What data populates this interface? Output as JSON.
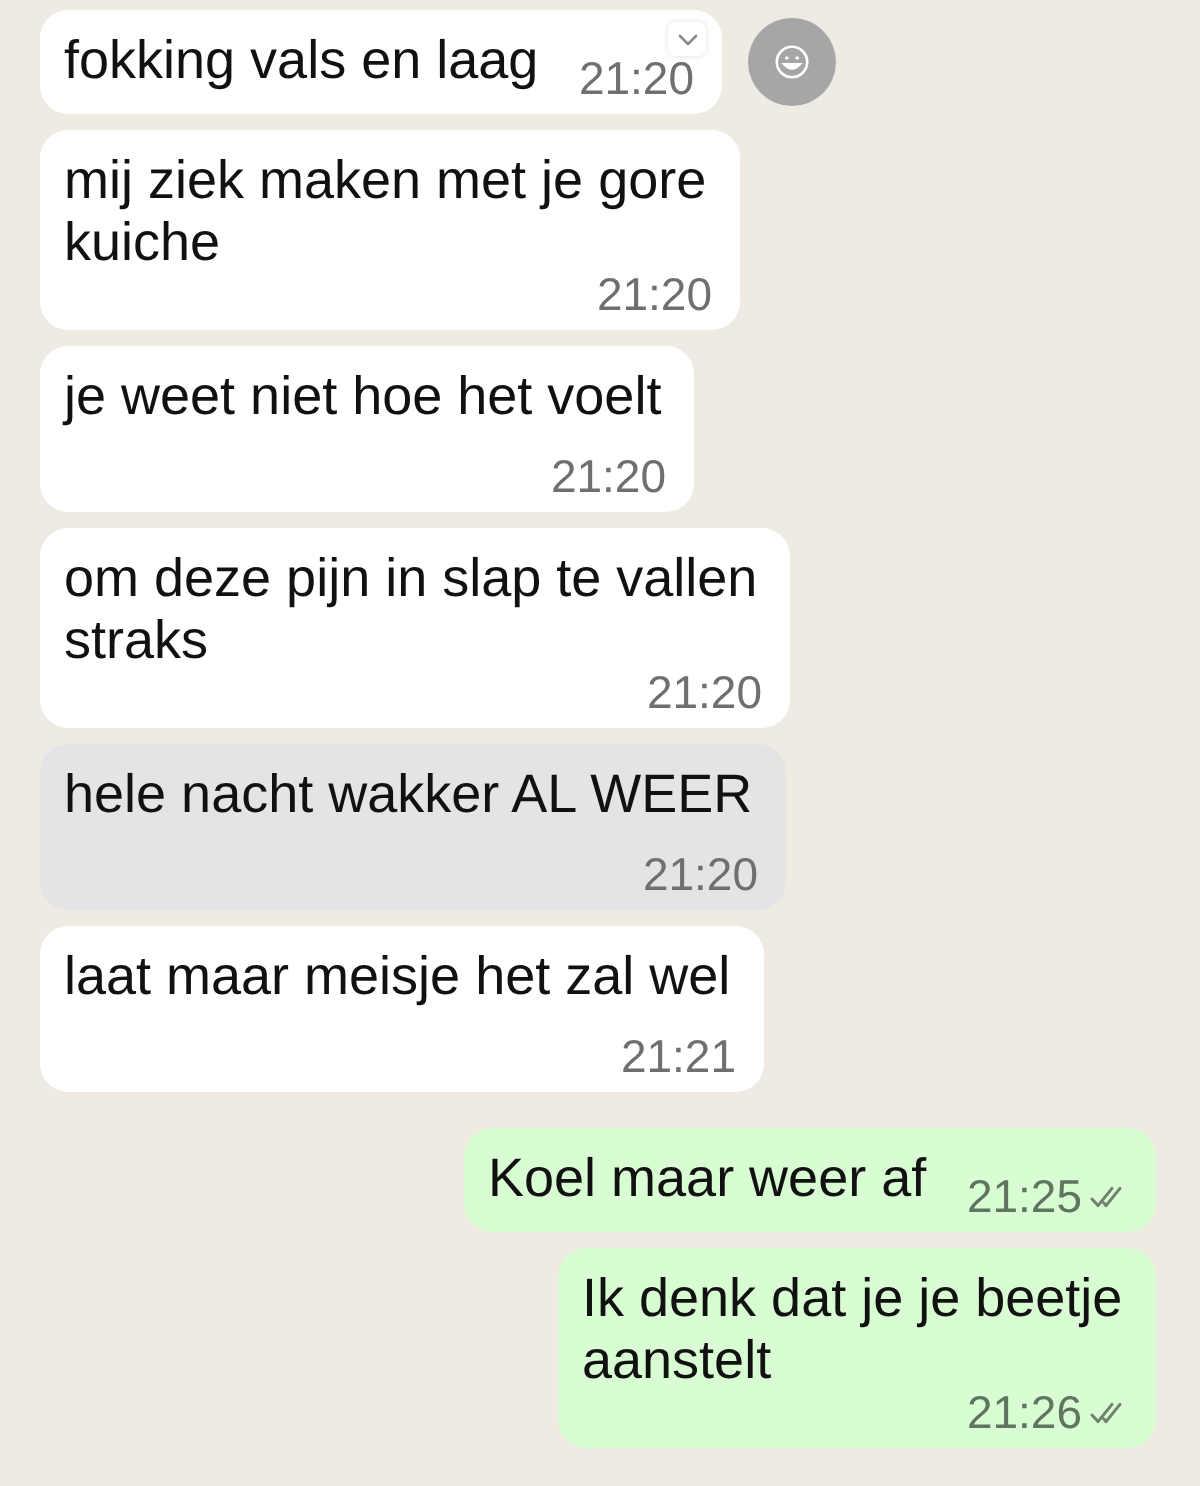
{
  "messages": [
    {
      "kind": "incoming",
      "text": "fokking vals en laag",
      "time": "21:20",
      "highlighted": false,
      "hovered": true
    },
    {
      "kind": "incoming",
      "text": "mij ziek maken met je gore kuiche",
      "time": "21:20",
      "highlighted": false,
      "hovered": false
    },
    {
      "kind": "incoming",
      "text": "je weet niet hoe het voelt",
      "time": "21:20",
      "highlighted": false,
      "hovered": false
    },
    {
      "kind": "incoming",
      "text": "om deze pijn in slap te vallen straks",
      "time": "21:20",
      "highlighted": false,
      "hovered": false
    },
    {
      "kind": "incoming",
      "text": "hele nacht wakker AL WEER",
      "time": "21:20",
      "highlighted": true,
      "hovered": false
    },
    {
      "kind": "incoming",
      "text": "laat maar meisje het zal wel",
      "time": "21:21",
      "highlighted": false,
      "hovered": false
    },
    {
      "kind": "outgoing",
      "text": "Koel maar weer af",
      "time": "21:25",
      "read": false,
      "highlighted": false,
      "hovered": false
    },
    {
      "kind": "outgoing",
      "text": "Ik denk dat je je beetje aanstelt",
      "time": "21:26",
      "read": false,
      "highlighted": false,
      "hovered": false
    }
  ]
}
